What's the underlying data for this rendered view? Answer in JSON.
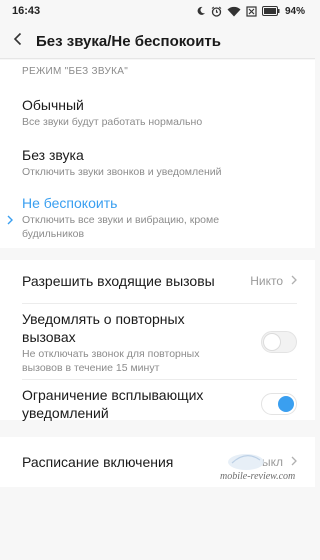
{
  "status_bar": {
    "time": "16:43",
    "battery": "94%",
    "icons": [
      "moon-icon",
      "alarm-icon",
      "wifi-icon",
      "no-sim-icon",
      "battery-icon"
    ]
  },
  "header": {
    "title": "Без звука/Не беспокоить",
    "back_icon": "back-arrow-icon"
  },
  "mode_section": {
    "header": "РЕЖИМ \"БЕЗ ЗВУКА\"",
    "options": [
      {
        "title": "Обычный",
        "subtitle": "Все звуки будут работать нормально",
        "selected": false
      },
      {
        "title": "Без звука",
        "subtitle": "Отключить звуки звонков и уведомлений",
        "selected": false
      },
      {
        "title": "Не беспокоить",
        "subtitle_line1": "Отключить все звуки и вибрацию, кроме",
        "subtitle_line2": "будильников",
        "selected": true
      }
    ]
  },
  "settings": {
    "allow_calls": {
      "label": "Разрешить входящие вызовы",
      "value": "Никто"
    },
    "repeat_calls": {
      "label_line1": "Уведомлять о повторных",
      "label_line2": "вызовах",
      "sub_line1": "Не отключать звонок для повторных",
      "sub_line2": "вызовов в течение 15 минут",
      "enabled": false
    },
    "popup_limit": {
      "label_line1": "Ограничение всплывающих",
      "label_line2": "уведомлений",
      "enabled": true
    }
  },
  "schedule": {
    "label": "Расписание включения",
    "value": "ыкл"
  },
  "watermark": "mobile-review.com",
  "colors": {
    "accent": "#3a9ff0",
    "background": "#f7f7f7",
    "card": "#ffffff"
  }
}
